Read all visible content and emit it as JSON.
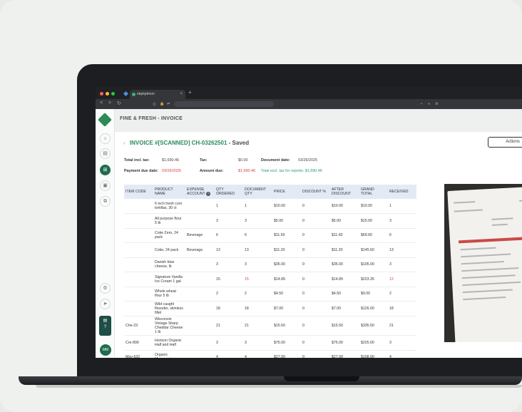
{
  "browser": {
    "tab_title": "ebpkptmon",
    "nav_icons": [
      "<",
      ">",
      "↻"
    ],
    "url_icons": [
      "⓪",
      "🔒",
      "⇄"
    ],
    "right_icons": [
      "▪",
      "●",
      "⚙"
    ]
  },
  "app": {
    "title": "FINE & FRESH - INVOICE",
    "avatar": "MM"
  },
  "invoice": {
    "back": "‹",
    "number": "INVOICE #[SCANNED] CH-03262501",
    "status": "- Saved",
    "actions_label": "Actions"
  },
  "summary": {
    "total_incl_tax_label": "Total incl. tax:",
    "total_incl_tax": "$1,690.46",
    "tax_label": "Tax:",
    "tax": "$0.00",
    "document_date_label": "Document date:",
    "document_date": "03/26/2025",
    "payment_due_label": "Payment due date:",
    "payment_due": "03/26/2025",
    "amount_due_label": "Amount due:",
    "amount_due": "$1,690.46",
    "total_excl_tax_text": "Total excl. tax for reports: $1,690.46"
  },
  "table": {
    "headers": [
      "ITEM CODE",
      "PRODUCT NAME",
      "EXPENSE ACCOUNT",
      "QTY ORDERED",
      "DOCUMENT QTY",
      "PRICE",
      "DISCOUNT %",
      "AFTER DISCOUNT",
      "GRAND TOTAL",
      "RECEIVED"
    ],
    "help_icon": "?",
    "rows": [
      {
        "code": "",
        "name": "6 inch fresh corn tortillas, 30 ct",
        "account": "",
        "qty": "1",
        "doc_qty": "1",
        "price": "$10.00",
        "disc": "0",
        "after": "$10.00",
        "total": "$10.00",
        "received": "1"
      },
      {
        "code": "",
        "name": "All purpose flour 5 lb",
        "account": "",
        "qty": "3",
        "doc_qty": "3",
        "price": "$5.00",
        "disc": "0",
        "after": "$5.00",
        "total": "$15.00",
        "received": "3"
      },
      {
        "code": "",
        "name": "Coke Zero, 24 pack",
        "account": "Beverage",
        "qty": "6",
        "doc_qty": "6",
        "price": "$11.60",
        "disc": "0",
        "after": "$11.60",
        "total": "$69.60",
        "received": "6"
      },
      {
        "code": "",
        "name": "Coke, 24 pack",
        "account": "Beverage",
        "qty": "13",
        "doc_qty": "13",
        "price": "$11.20",
        "disc": "0",
        "after": "$11.20",
        "total": "$145.60",
        "received": "13"
      },
      {
        "code": "",
        "name": "Danish blue cheese, lb",
        "account": "",
        "qty": "3",
        "doc_qty": "3",
        "price": "$35.00",
        "disc": "0",
        "after": "$35.00",
        "total": "$105.00",
        "received": "3"
      },
      {
        "code": "",
        "name": "Signature Vanilla Ice Cream 1 gal",
        "account": "",
        "qty": "15",
        "doc_qty": "15",
        "price": "$14.89",
        "disc": "0",
        "after": "$14.89",
        "total": "$223.35",
        "received": "12"
      },
      {
        "code": "",
        "name": "Whole wheat flour 5 lb",
        "account": "",
        "qty": "2",
        "doc_qty": "2",
        "price": "$4.50",
        "disc": "0",
        "after": "$4.50",
        "total": "$9.00",
        "received": "2"
      },
      {
        "code": "",
        "name": "Wild caught flounder, skinless fillet",
        "account": "",
        "qty": "18",
        "doc_qty": "18",
        "price": "$7.00",
        "disc": "0",
        "after": "$7.00",
        "total": "$126.00",
        "received": "18"
      },
      {
        "code": "Che-23",
        "name": "Wisconsin Vintage Sharp Cheddar Cheese 1 lb",
        "account": "",
        "qty": "21",
        "doc_qty": "21",
        "price": "$15.50",
        "disc": "0",
        "after": "$15.50",
        "total": "$335.50",
        "received": "21"
      },
      {
        "code": "Cre-899",
        "name": "Horizon Organic Half and Half",
        "account": "",
        "qty": "3",
        "doc_qty": "3",
        "price": "$75.00",
        "disc": "0",
        "after": "$75.00",
        "total": "$225.00",
        "received": "3"
      },
      {
        "code": "May-632",
        "name": "Organic Mayonnaise",
        "account": "",
        "qty": "4",
        "doc_qty": "4",
        "price": "$27.00",
        "disc": "0",
        "after": "$27.00",
        "total": "$108.00",
        "received": "4"
      }
    ]
  },
  "colors": {
    "accent": "#2a8a5c",
    "alert": "#d9413d",
    "header_bg": "#e3eaf6"
  }
}
